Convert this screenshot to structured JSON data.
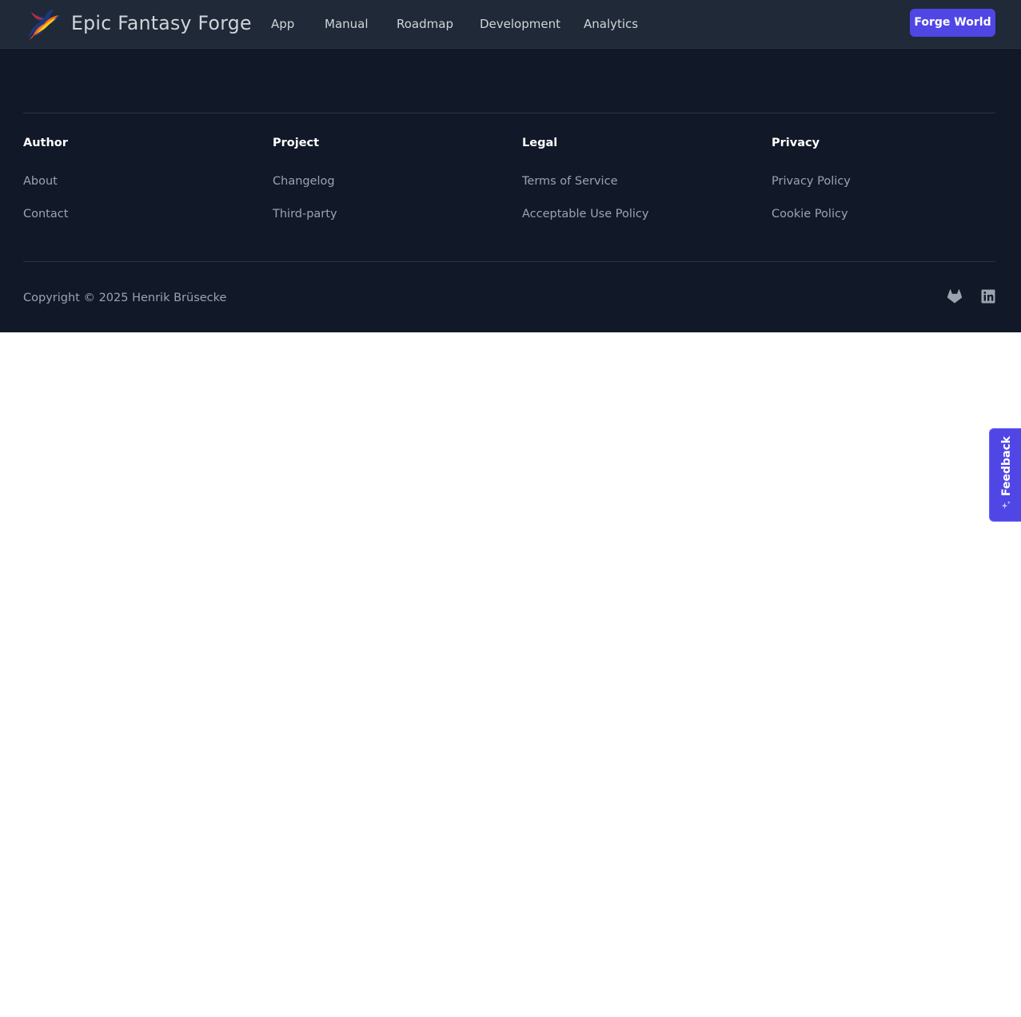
{
  "header": {
    "brand": "Epic Fantasy Forge",
    "logo_icon": "phoenix-logo-icon",
    "nav": [
      {
        "label": "App"
      },
      {
        "label": "Manual"
      },
      {
        "label": "Roadmap"
      },
      {
        "label": "Development"
      },
      {
        "label": "Analytics"
      }
    ],
    "cta_label": "Forge World"
  },
  "footer": {
    "columns": [
      {
        "heading": "Author",
        "links": [
          "About",
          "Contact"
        ]
      },
      {
        "heading": "Project",
        "links": [
          "Changelog",
          "Third-party"
        ]
      },
      {
        "heading": "Legal",
        "links": [
          "Terms of Service",
          "Acceptable Use Policy"
        ]
      },
      {
        "heading": "Privacy",
        "links": [
          "Privacy Policy",
          "Cookie Policy"
        ]
      }
    ],
    "copyright": "Copyright © 2025 Henrik Brüsecke",
    "social": [
      {
        "icon": "gitlab-icon"
      },
      {
        "icon": "linkedin-icon"
      }
    ]
  },
  "feedback": {
    "label": "Feedback",
    "icon": "sparkles-icon"
  },
  "colors": {
    "header_bg": "#1f2937",
    "footer_bg": "#111827",
    "accent": "#4f46e5",
    "muted_text": "#9ca3af",
    "heading_text": "#ffffff"
  }
}
